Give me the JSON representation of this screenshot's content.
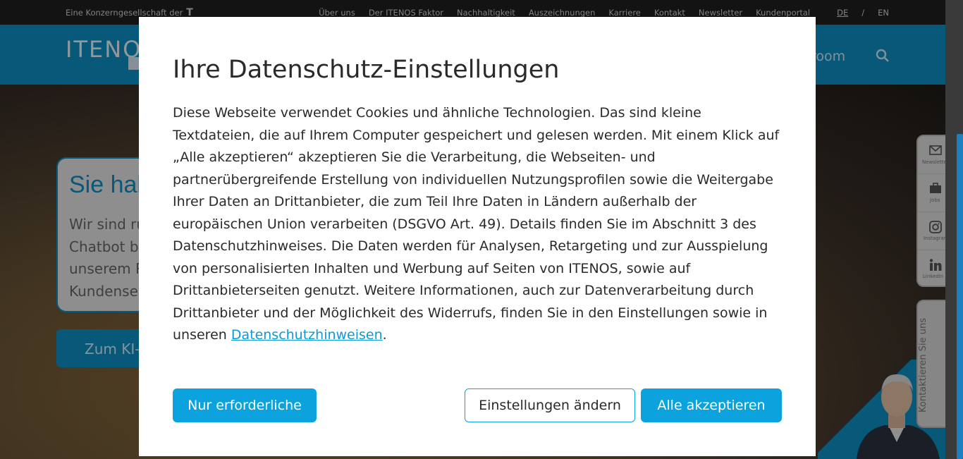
{
  "topbar": {
    "group_text": "Eine Konzerngesellschaft der",
    "group_logo": "T",
    "nav": [
      "Über uns",
      "Der ITENOS Faktor",
      "Nachhaltigkeit",
      "Auszeichnungen",
      "Karriere",
      "Kontakt",
      "Newsletter",
      "Kundenportal"
    ],
    "lang_de": "DE",
    "lang_sep": "/",
    "lang_en": "EN"
  },
  "header": {
    "logo_text": "ITENO",
    "nav_last_fragment": "room"
  },
  "hero": {
    "title_fragment": "Sie hab",
    "text_lines": [
      "Wir sind ru",
      "Chatbot be",
      "unserem R",
      "Kundense"
    ],
    "button_fragment": "Zum KI-"
  },
  "rail": {
    "items": [
      {
        "label": "Newsletter",
        "icon": "mail-icon"
      },
      {
        "label": "Jobs",
        "icon": "briefcase-icon"
      },
      {
        "label": "Instagram",
        "icon": "instagram-icon"
      },
      {
        "label": "LinkedIn",
        "icon": "linkedin-icon"
      }
    ],
    "contact": "Kontaktieren Sie uns"
  },
  "modal": {
    "title": "Ihre Datenschutz-Einstellungen",
    "body": "Diese Webseite verwendet Cookies und ähnliche Technologien. Das sind kleine Textdateien, die auf Ihrem Computer gespeichert und gelesen werden. Mit einem Klick auf „Alle akzeptieren“ akzeptieren Sie die Verarbeitung, die Webseiten- und partnerübergreifende Erstellung von individuellen Nutzungsprofilen sowie die Weitergabe Ihrer Daten an Drittanbieter, die zum Teil Ihre Daten in Ländern außerhalb der europäischen Union verarbeiten (DSGVO Art. 49). Details finden Sie im Abschnitt 3 des Datenschutzhinweises. Die Daten werden für Analysen, Retargeting und zur Ausspielung von personalisierten Inhalten und Werbung auf Seiten von ITENOS, sowie auf Drittanbieterseiten genutzt. Weitere Informationen, auch zur Datenverarbeitung durch Drittanbieter und der Möglichkeit des Widerrufs, finden Sie in den Einstellungen sowie in unseren ",
    "link": "Datenschutzhinweisen",
    "body_end": ".",
    "btn_required": "Nur erforderliche",
    "btn_settings": "Einstellungen ändern",
    "btn_accept": "Alle akzeptieren"
  },
  "colors": {
    "brand_blue": "#0c8fc4",
    "button_blue": "#0ca2de",
    "link_blue": "#0a9bd6"
  }
}
